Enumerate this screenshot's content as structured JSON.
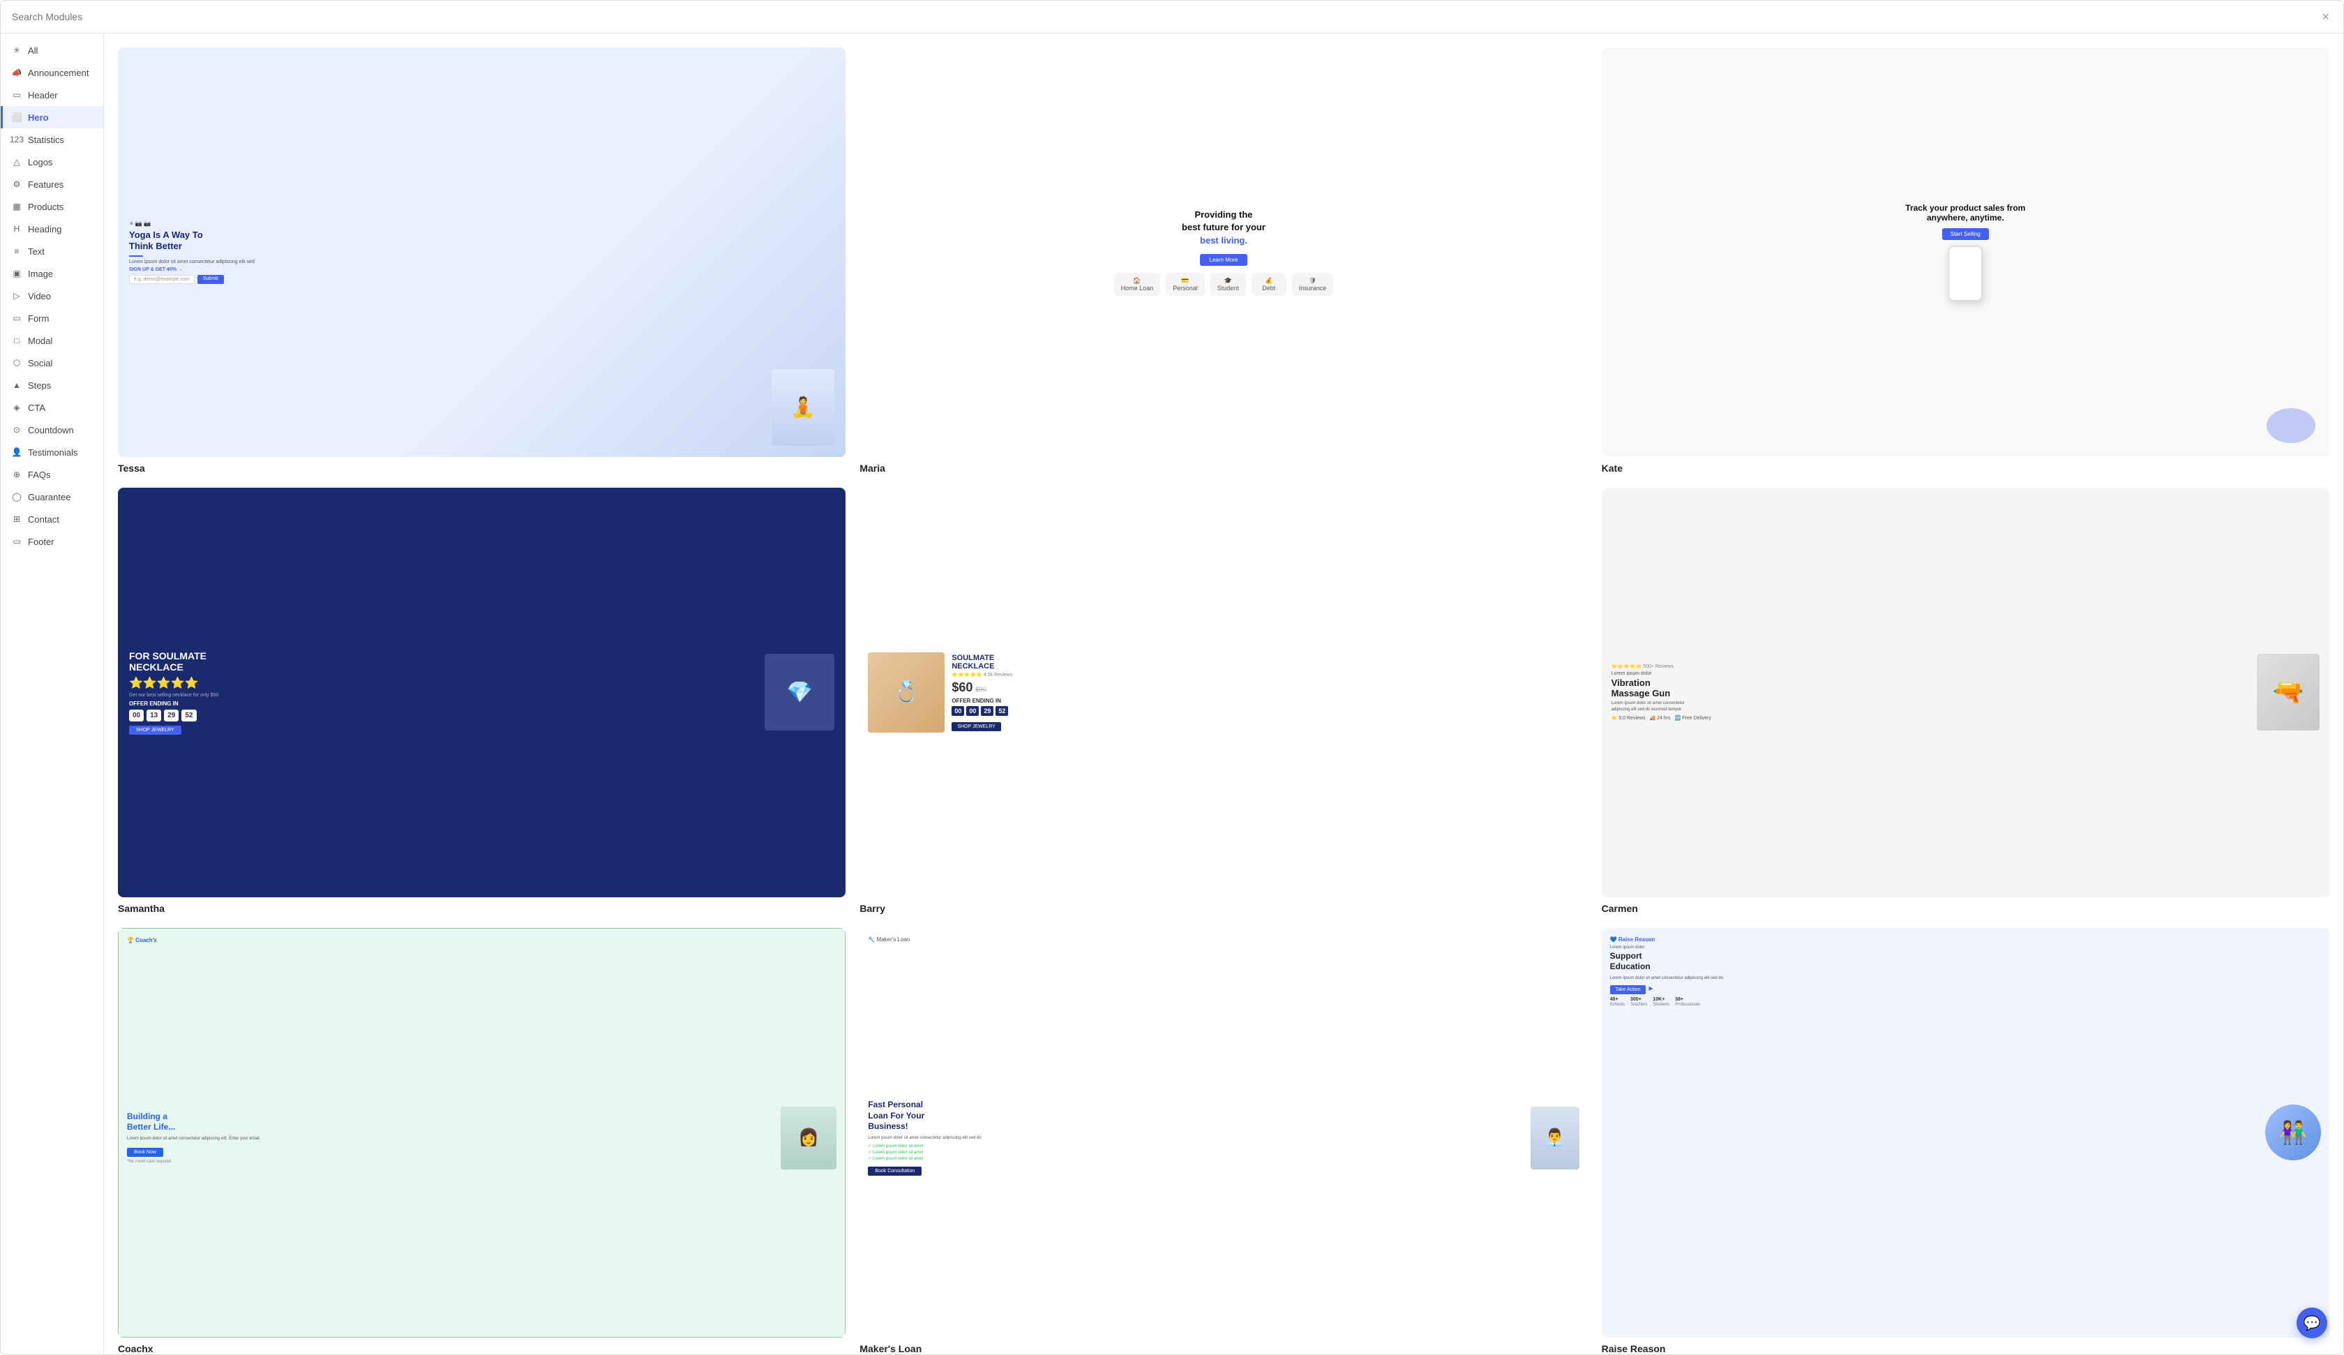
{
  "header": {
    "search_placeholder": "Search Modules",
    "close_label": "×"
  },
  "sidebar": {
    "items": [
      {
        "id": "all",
        "label": "All",
        "icon": "✳"
      },
      {
        "id": "announcement",
        "label": "Announcement",
        "icon": "📣"
      },
      {
        "id": "header",
        "label": "Header",
        "icon": "▭"
      },
      {
        "id": "hero",
        "label": "Hero",
        "icon": "⬜",
        "active": true
      },
      {
        "id": "statistics",
        "label": "Statistics",
        "icon": "123"
      },
      {
        "id": "logos",
        "label": "Logos",
        "icon": "△"
      },
      {
        "id": "features",
        "label": "Features",
        "icon": "⚙"
      },
      {
        "id": "products",
        "label": "Products",
        "icon": "▦"
      },
      {
        "id": "heading",
        "label": "Heading",
        "icon": "H"
      },
      {
        "id": "text",
        "label": "Text",
        "icon": "≡"
      },
      {
        "id": "image",
        "label": "Image",
        "icon": "▣"
      },
      {
        "id": "video",
        "label": "Video",
        "icon": "▷"
      },
      {
        "id": "form",
        "label": "Form",
        "icon": "▭"
      },
      {
        "id": "modal",
        "label": "Modal",
        "icon": "□"
      },
      {
        "id": "social",
        "label": "Social",
        "icon": "⬡"
      },
      {
        "id": "steps",
        "label": "Steps",
        "icon": "▲"
      },
      {
        "id": "cta",
        "label": "CTA",
        "icon": "◈"
      },
      {
        "id": "countdown",
        "label": "Countdown",
        "icon": "⊙"
      },
      {
        "id": "testimonials",
        "label": "Testimonials",
        "icon": "👤"
      },
      {
        "id": "faqs",
        "label": "FAQs",
        "icon": "⊕"
      },
      {
        "id": "guarantee",
        "label": "Guarantee",
        "icon": "◯"
      },
      {
        "id": "contact",
        "label": "Contact",
        "icon": "⊞"
      },
      {
        "id": "footer",
        "label": "Footer",
        "icon": "▭"
      }
    ]
  },
  "main": {
    "cards": [
      {
        "id": "tessa",
        "label": "Tessa",
        "preview_type": "tessa",
        "heading": "Yoga Is A Way To Think Better",
        "theme": "blue-light"
      },
      {
        "id": "maria",
        "label": "Maria",
        "preview_type": "maria",
        "heading": "Providing the best future for your best living.",
        "theme": "white"
      },
      {
        "id": "kate",
        "label": "Kate",
        "preview_type": "kate",
        "heading": "Track your product sales from anywhere, anytime.",
        "theme": "light-gray"
      },
      {
        "id": "samantha",
        "label": "Samantha",
        "preview_type": "samantha",
        "heading": "FOR SOULMATE NECKLACE",
        "theme": "dark-blue"
      },
      {
        "id": "barry",
        "label": "Barry",
        "preview_type": "barry",
        "heading": "SOULMATE NECKLACE",
        "theme": "white"
      },
      {
        "id": "carmen",
        "label": "Carmen",
        "preview_type": "carmen",
        "heading": "Vibration Massage Gun",
        "theme": "light-gray"
      },
      {
        "id": "coachx",
        "label": "Coachx",
        "preview_type": "coachx",
        "heading": "Building a Better Life...",
        "theme": "light-blue"
      },
      {
        "id": "maker",
        "label": "Maker's Loan",
        "preview_type": "maker",
        "heading": "Fast Personal Loan For Your Business!",
        "theme": "white"
      },
      {
        "id": "raise",
        "label": "Raise Reason",
        "preview_type": "raise",
        "heading": "Support Education",
        "theme": "light-blue"
      }
    ]
  },
  "chat": {
    "icon": "💬"
  }
}
